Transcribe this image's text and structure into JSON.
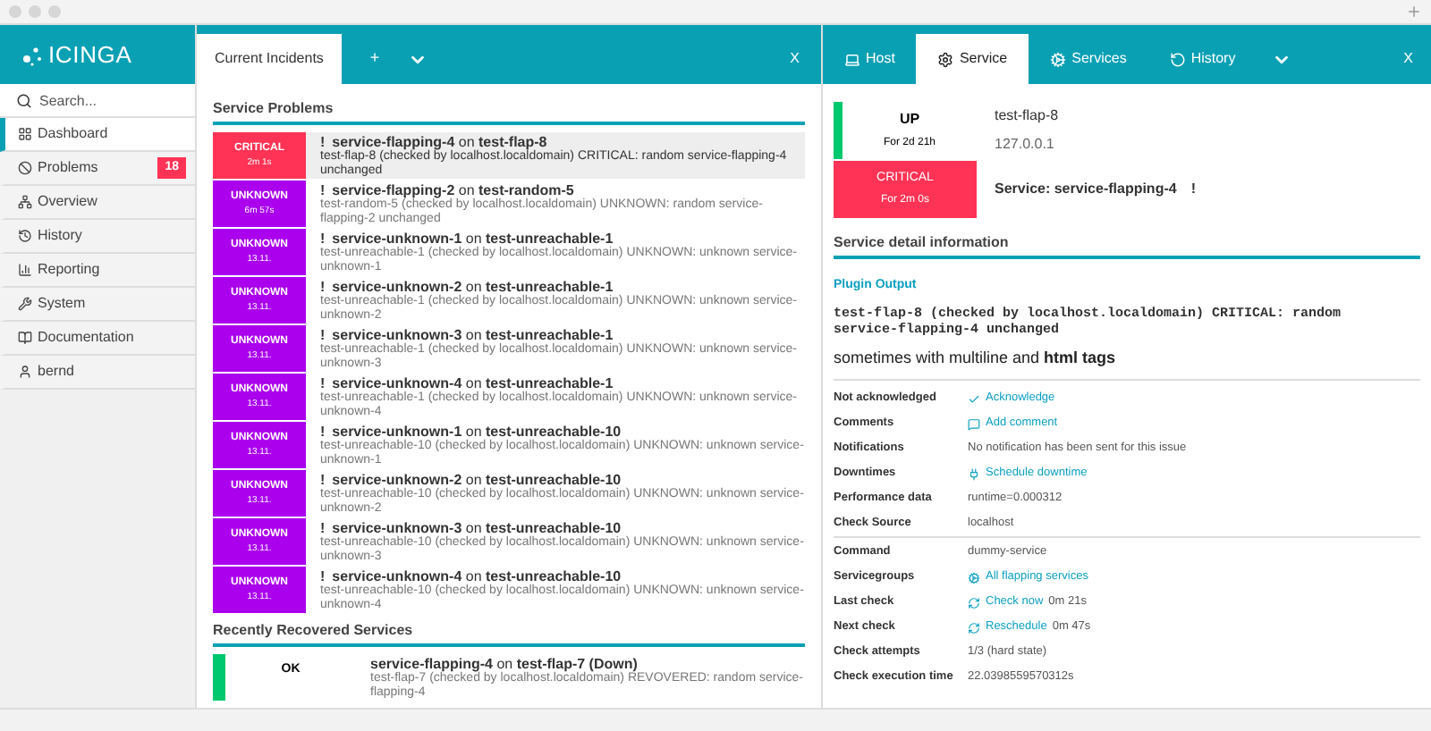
{
  "brand": "ICINGA",
  "sidebar": {
    "search": {
      "placeholder": "Search..."
    },
    "items": [
      {
        "label": "Dashboard",
        "kind": "dashboard",
        "selected": true
      },
      {
        "label": "Problems",
        "kind": "problems",
        "selected": false,
        "badge": "18"
      },
      {
        "label": "Overview",
        "kind": "overview",
        "selected": false
      },
      {
        "label": "History",
        "kind": "history",
        "selected": false
      },
      {
        "label": "Reporting",
        "kind": "reporting",
        "selected": false
      },
      {
        "label": "System",
        "kind": "system",
        "selected": false
      },
      {
        "label": "Documentation",
        "kind": "documentation",
        "selected": false
      },
      {
        "label": "bernd",
        "kind": "user",
        "selected": false
      }
    ]
  },
  "left_pane": {
    "tabs": [
      {
        "label": "Current Incidents",
        "selected": true
      }
    ],
    "add_tab": "+",
    "close": "X",
    "sections": [
      {
        "title": "Service Problems",
        "rows": [
          {
            "state": "CRITICAL",
            "color": "#ff3355",
            "since": "2m 1s",
            "flag": "!",
            "service": "service-flapping-4",
            "on": "on",
            "host": "test-flap-8",
            "output": "test-flap-8 (checked by localhost.localdomain) CRITICAL: random service-flapping-4 unchanged",
            "selected": true
          },
          {
            "state": "UNKNOWN",
            "color": "#aa00ee",
            "since": "6m 57s",
            "flag": "!",
            "service": "service-flapping-2",
            "on": "on",
            "host": "test-random-5",
            "output": "test-random-5 (checked by localhost.localdomain) UNKNOWN: random service-flapping-2 unchanged",
            "selected": false
          },
          {
            "state": "UNKNOWN",
            "color": "#aa00ee",
            "since": "13.11.",
            "flag": "!",
            "service": "service-unknown-1",
            "on": "on",
            "host": "test-unreachable-1",
            "output": "test-unreachable-1 (checked by localhost.localdomain) UNKNOWN: unknown service-unknown-1",
            "selected": false
          },
          {
            "state": "UNKNOWN",
            "color": "#aa00ee",
            "since": "13.11.",
            "flag": "!",
            "service": "service-unknown-2",
            "on": "on",
            "host": "test-unreachable-1",
            "output": "test-unreachable-1 (checked by localhost.localdomain) UNKNOWN: unknown service-unknown-2",
            "selected": false
          },
          {
            "state": "UNKNOWN",
            "color": "#aa00ee",
            "since": "13.11.",
            "flag": "!",
            "service": "service-unknown-3",
            "on": "on",
            "host": "test-unreachable-1",
            "output": "test-unreachable-1 (checked by localhost.localdomain) UNKNOWN: unknown service-unknown-3",
            "selected": false
          },
          {
            "state": "UNKNOWN",
            "color": "#aa00ee",
            "since": "13.11.",
            "flag": "!",
            "service": "service-unknown-4",
            "on": "on",
            "host": "test-unreachable-1",
            "output": "test-unreachable-1 (checked by localhost.localdomain) UNKNOWN: unknown service-unknown-4",
            "selected": false
          },
          {
            "state": "UNKNOWN",
            "color": "#aa00ee",
            "since": "13.11.",
            "flag": "!",
            "service": "service-unknown-1",
            "on": "on",
            "host": "test-unreachable-10",
            "output": "test-unreachable-10 (checked by localhost.localdomain) UNKNOWN: unknown service-unknown-1",
            "selected": false
          },
          {
            "state": "UNKNOWN",
            "color": "#aa00ee",
            "since": "13.11.",
            "flag": "!",
            "service": "service-unknown-2",
            "on": "on",
            "host": "test-unreachable-10",
            "output": "test-unreachable-10 (checked by localhost.localdomain) UNKNOWN: unknown service-unknown-2",
            "selected": false
          },
          {
            "state": "UNKNOWN",
            "color": "#aa00ee",
            "since": "13.11.",
            "flag": "!",
            "service": "service-unknown-3",
            "on": "on",
            "host": "test-unreachable-10",
            "output": "test-unreachable-10 (checked by localhost.localdomain) UNKNOWN: unknown service-unknown-3",
            "selected": false
          },
          {
            "state": "UNKNOWN",
            "color": "#aa00ee",
            "since": "13.11.",
            "flag": "!",
            "service": "service-unknown-4",
            "on": "on",
            "host": "test-unreachable-10",
            "output": "test-unreachable-10 (checked by localhost.localdomain) UNKNOWN: unknown service-unknown-4",
            "selected": false
          }
        ]
      },
      {
        "title": "Recently Recovered Services",
        "rows": [
          {
            "state": "OK",
            "color": "#00c86e",
            "service": "service-flapping-4",
            "on": "on",
            "host": "test-flap-7 (Down)",
            "output": "test-flap-7 (checked by localhost.localdomain) REVOVERED: random service-flapping-4",
            "selected": false
          }
        ]
      }
    ]
  },
  "right_pane": {
    "tabs": [
      {
        "label": "Host",
        "kind": "host",
        "selected": false
      },
      {
        "label": "Service",
        "kind": "service",
        "selected": true
      },
      {
        "label": "Services",
        "kind": "services",
        "selected": false
      },
      {
        "label": "History",
        "kind": "history",
        "selected": false
      }
    ],
    "close": "X",
    "host": {
      "state": "UP",
      "color": "#00c86e",
      "since": "For 2d 21h",
      "name": "test-flap-8",
      "address": "127.0.0.1"
    },
    "service": {
      "state": "CRITICAL",
      "color": "#ff3355",
      "since": "For 2m 0s",
      "name": "Service: service-flapping-4",
      "flag": "!"
    },
    "detail_title": "Service detail information",
    "plugin_title": "Plugin Output",
    "plugin_output": "test-flap-8 (checked by localhost.localdomain) CRITICAL: random service-flapping-4 unchanged",
    "plugin_extra": "sometimes with multiline and **html tags**",
    "groups": [
      [
        {
          "label": "Not acknowledged",
          "kind": "ack",
          "value": "Acknowledge"
        },
        {
          "label": "Comments",
          "kind": "comment",
          "value": "Add comment"
        },
        {
          "label": "Notifications",
          "kind": "text",
          "value": "No notification has been sent for this issue"
        },
        {
          "label": "Downtimes",
          "kind": "downtime",
          "value": "Schedule downtime"
        },
        {
          "label": "Performance data",
          "kind": "text",
          "value": "runtime=0.000312"
        },
        {
          "label": "Check Source",
          "kind": "text",
          "value": "localhost"
        }
      ],
      [
        {
          "label": "Command",
          "kind": "text",
          "value": "dummy-service"
        },
        {
          "label": "Servicegroups",
          "kind": "group",
          "value": "All flapping services"
        },
        {
          "label": "Last check",
          "kind": "refresh",
          "value": "Check now",
          "extra": "0m 21s"
        },
        {
          "label": "Next check",
          "kind": "refresh",
          "value": "Reschedule",
          "extra": "0m 47s"
        },
        {
          "label": "Check attempts",
          "kind": "text",
          "value": "1/3 (hard state)"
        },
        {
          "label": "Check execution time",
          "kind": "text",
          "value": "22.0398559570312s"
        }
      ]
    ]
  }
}
